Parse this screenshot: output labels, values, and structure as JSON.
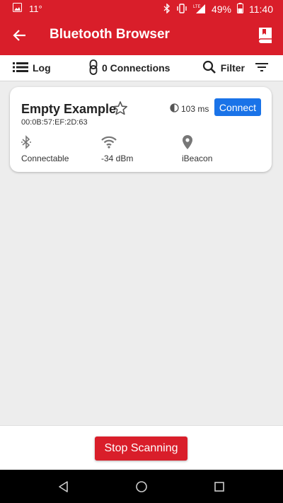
{
  "colors": {
    "brand": "#d91e2a",
    "accent": "#1a73e8"
  },
  "status_bar": {
    "temperature": "11°",
    "battery": "49%",
    "time": "11:40"
  },
  "app_bar": {
    "title": "Bluetooth Browser"
  },
  "toolbar": {
    "log_label": "Log",
    "connections_label": "0 Connections",
    "filter_label": "Filter"
  },
  "device": {
    "name": "Empty Example",
    "mac": "00:0B:57:EF:2D:63",
    "interval": "103 ms",
    "connect_label": "Connect",
    "connectable": "Connectable",
    "rssi": "-34 dBm",
    "type": "iBeacon"
  },
  "scan_button": {
    "label": "Stop Scanning"
  }
}
